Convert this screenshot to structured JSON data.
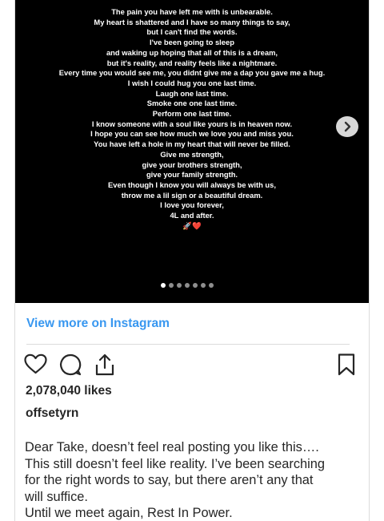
{
  "post": {
    "poem_lines": [
      "The pain you have left me with is unbearable.",
      "My heart is shattered and I have so many things to say,",
      "but I can't find the words.",
      "I've been going to sleep",
      "and waking up hoping that all of this is a dream,",
      "but it's reality, and reality feels like a nightmare.",
      "Every time you would see me, you didnt give me a dap you gave me a hug.",
      "I wish I could hug you one last time.",
      "Laugh one last time.",
      "Smoke one one last time.",
      "Perform one last time.",
      "I know someone with a soul like yours is in heaven now.",
      "I hope you can see how much we love you and miss you.",
      "You have left a hole in my heart that will never be filled.",
      "Give me strength,",
      "give your brothers strength,",
      "give your family strength.",
      "Even though I know you will always be with us,",
      "throw me a lil sign or a beautiful dream.",
      "I love you forever,",
      "4L and after.",
      "🚀❤️"
    ],
    "carousel": {
      "count": 7,
      "active_index": 0
    },
    "view_more_label": "View more on Instagram",
    "likes_label": "2,078,040 likes",
    "username": "offsetyrn",
    "caption_lines": [
      "Dear Take, doesn’t feel real posting you like this….",
      "This still doesn’t feel like reality. I’ve been searching",
      "for the right words to say, but there aren’t any that",
      "will suffice.",
      "Until we meet again, Rest In Power."
    ]
  },
  "icons": {
    "like": "heart-icon",
    "comment": "comment-icon",
    "share": "share-icon",
    "save": "bookmark-icon",
    "next": "chevron-right-icon"
  },
  "colors": {
    "link": "#3897f0",
    "text": "#262626",
    "media_bg": "#000000",
    "divider": "#dbdbdb"
  }
}
